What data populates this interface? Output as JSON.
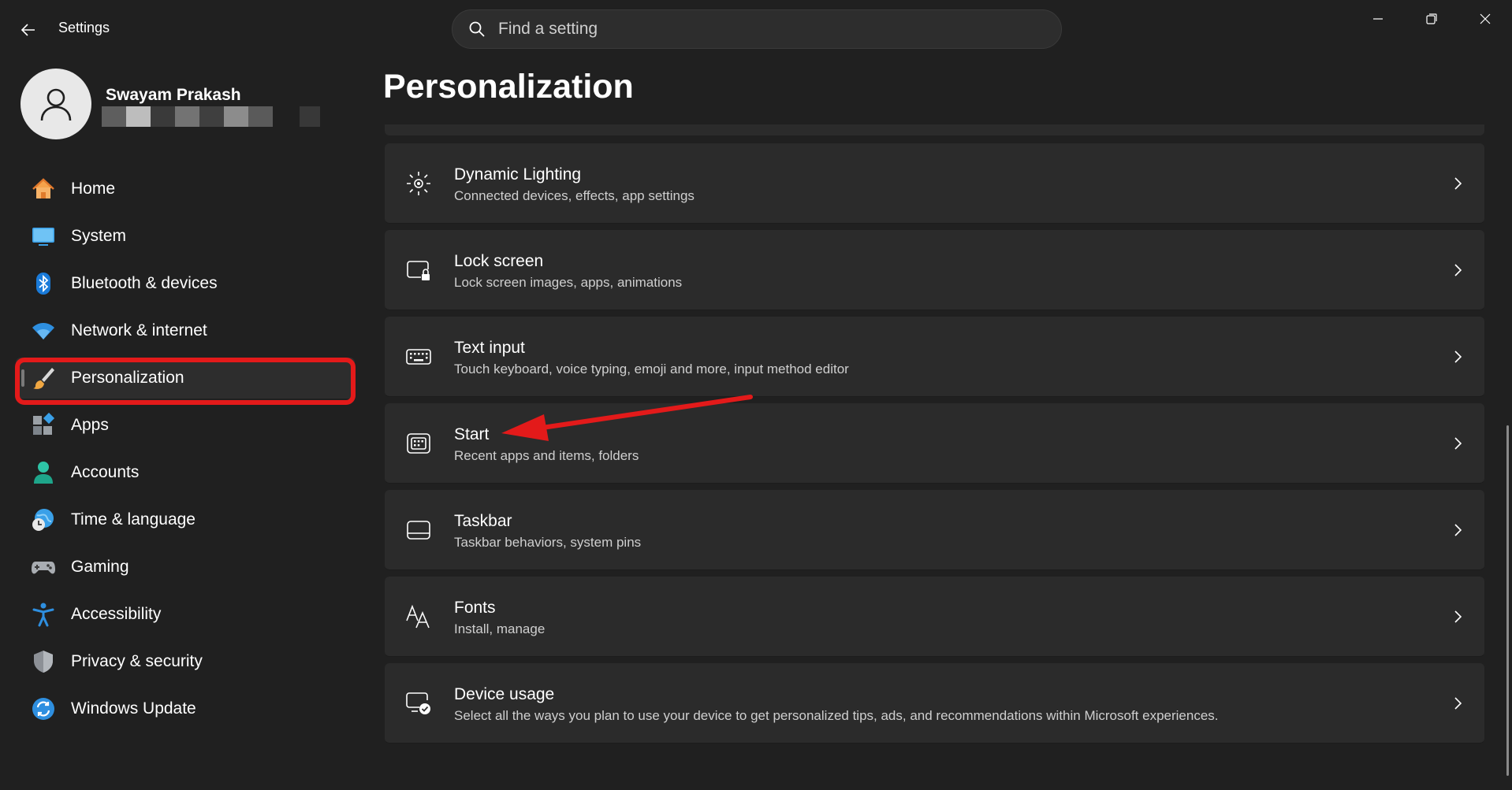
{
  "window": {
    "title": "Settings",
    "controls": [
      "minimize",
      "restore",
      "close"
    ]
  },
  "search": {
    "placeholder": "Find a setting"
  },
  "profile": {
    "name": "Swayam Prakash"
  },
  "sidebar": {
    "items": [
      {
        "label": "Home",
        "icon": "home-icon"
      },
      {
        "label": "System",
        "icon": "monitor-icon"
      },
      {
        "label": "Bluetooth & devices",
        "icon": "bluetooth-icon"
      },
      {
        "label": "Network & internet",
        "icon": "wifi-icon"
      },
      {
        "label": "Personalization",
        "icon": "brush-icon",
        "selected": true
      },
      {
        "label": "Apps",
        "icon": "apps-icon"
      },
      {
        "label": "Accounts",
        "icon": "person-icon"
      },
      {
        "label": "Time & language",
        "icon": "globe-clock-icon"
      },
      {
        "label": "Gaming",
        "icon": "gamepad-icon"
      },
      {
        "label": "Accessibility",
        "icon": "accessibility-icon"
      },
      {
        "label": "Privacy & security",
        "icon": "shield-icon"
      },
      {
        "label": "Windows Update",
        "icon": "update-icon"
      }
    ]
  },
  "main": {
    "title": "Personalization",
    "cards": [
      {
        "title": "Dynamic Lighting",
        "subtitle": "Connected devices, effects, app settings",
        "icon": "dynamic-lighting-icon"
      },
      {
        "title": "Lock screen",
        "subtitle": "Lock screen images, apps, animations",
        "icon": "lock-screen-icon"
      },
      {
        "title": "Text input",
        "subtitle": "Touch keyboard, voice typing, emoji and more, input method editor",
        "icon": "keyboard-icon"
      },
      {
        "title": "Start",
        "subtitle": "Recent apps and items, folders",
        "icon": "start-icon"
      },
      {
        "title": "Taskbar",
        "subtitle": "Taskbar behaviors, system pins",
        "icon": "taskbar-icon"
      },
      {
        "title": "Fonts",
        "subtitle": "Install, manage",
        "icon": "fonts-icon"
      },
      {
        "title": "Device usage",
        "subtitle": "Select all the ways you plan to use your device to get personalized tips, ads, and recommendations within Microsoft experiences.",
        "icon": "device-usage-icon"
      }
    ]
  },
  "colors": {
    "background": "#202020",
    "card": "#2b2b2b",
    "annotation_red": "#e31a1a",
    "accent_blue": "#4cc2ff"
  }
}
